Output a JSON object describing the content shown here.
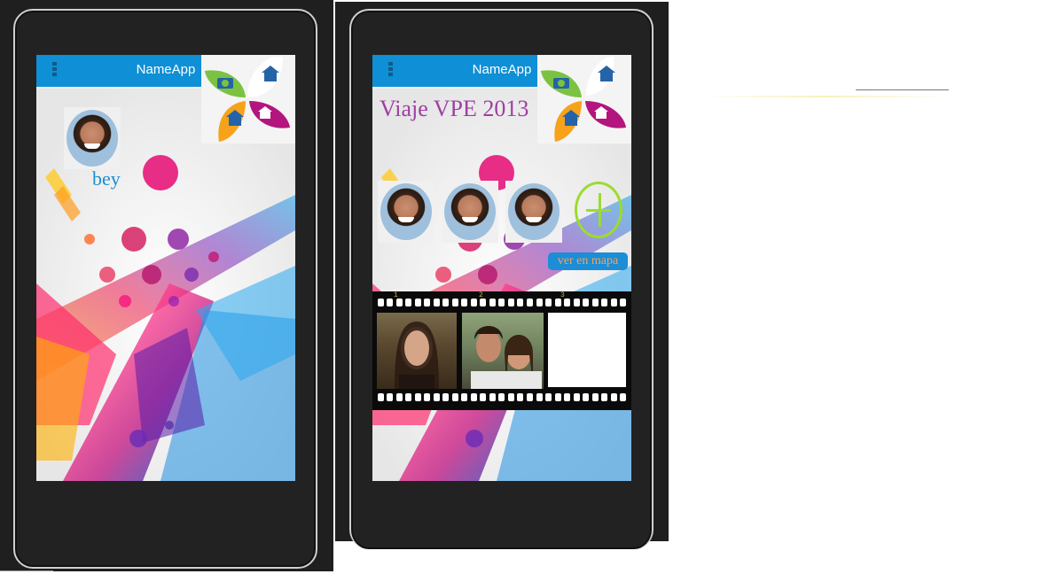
{
  "phones": [
    {
      "app_title": "NameApp",
      "avatar_caption": "bey"
    },
    {
      "app_title": "NameApp",
      "trip_title": "Viaje VPE 2013",
      "map_button": "ver en mapa",
      "film_labels": [
        "1",
        "2",
        "3"
      ]
    }
  ],
  "icons": {
    "menu": "overflow-menu-icon",
    "camera": "camera-icon",
    "home": "home-icon",
    "add": "plus-circle-icon"
  },
  "colors": {
    "appbar": "#0e8fd6",
    "caption": "#1a8fd0",
    "trip_title": "#9e3fa3",
    "add_button": "#9bdc2e",
    "map_button_bg": "#1c8dd6",
    "map_button_text": "#f2a35a"
  }
}
